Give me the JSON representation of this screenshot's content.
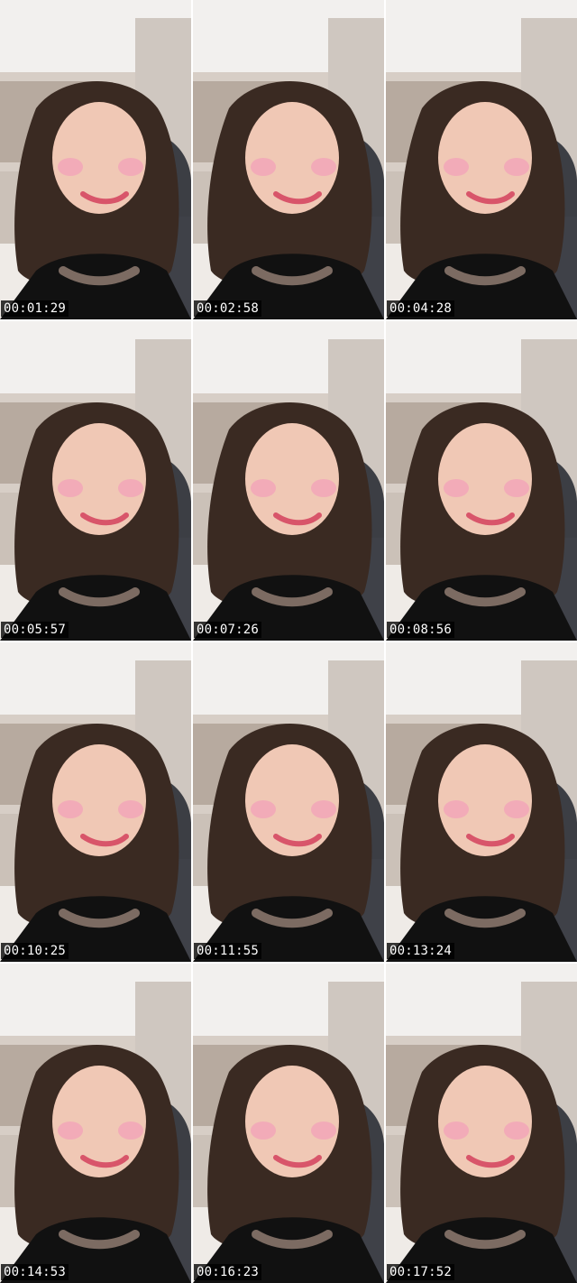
{
  "thumbnails": [
    {
      "timestamp": "00:01:29"
    },
    {
      "timestamp": "00:02:58"
    },
    {
      "timestamp": "00:04:28"
    },
    {
      "timestamp": "00:05:57"
    },
    {
      "timestamp": "00:07:26"
    },
    {
      "timestamp": "00:08:56"
    },
    {
      "timestamp": "00:10:25"
    },
    {
      "timestamp": "00:11:55"
    },
    {
      "timestamp": "00:13:24"
    },
    {
      "timestamp": "00:14:53"
    },
    {
      "timestamp": "00:16:23"
    },
    {
      "timestamp": "00:17:52"
    }
  ],
  "colors": {
    "ceiling": "#f1efed",
    "wall": "#d9d2cb",
    "patterned_wall": "#b7aa9f",
    "chair": "#2b2f36",
    "hair": "#3a2a22",
    "skin": "#f0c8b5",
    "blush": "#f2a6b8",
    "top": "#111111",
    "timestamp_bg": "#000000",
    "timestamp_text": "#ffffff"
  }
}
